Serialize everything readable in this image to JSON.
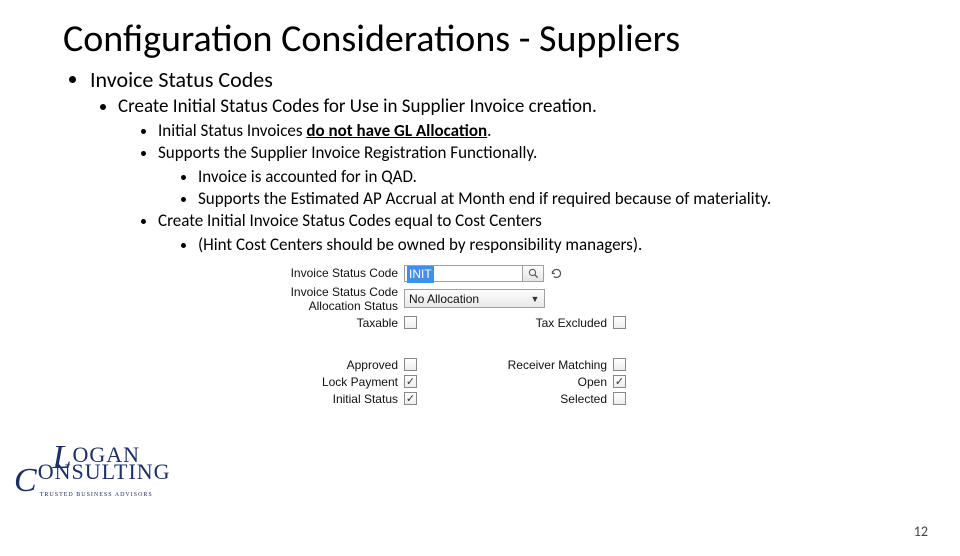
{
  "title": "Configuration Considerations - Suppliers",
  "bullets": {
    "l1": "Invoice Status Codes",
    "l2": "Create Initial Status Codes for Use in Supplier Invoice creation.",
    "l3a_pre": "Initial Status Invoices ",
    "l3a_emph": "do not have GL Allocation",
    "l3a_post": ".",
    "l3b": "Supports the Supplier Invoice Registration Functionally.",
    "l4a": "Invoice is accounted for in QAD.",
    "l4b": "Supports the Estimated AP Accrual at Month end if required because of materiality.",
    "l3c": "Create Initial Invoice Status Codes equal to Cost Centers",
    "l4c": "(Hint Cost Centers should be owned by responsibility managers)."
  },
  "form": {
    "labels": {
      "code": "Invoice Status Code",
      "alloc": "Invoice Status Code Allocation Status",
      "taxable": "Taxable",
      "tax_excluded": "Tax Excluded",
      "approved": "Approved",
      "receiver_matching": "Receiver Matching",
      "lock_payment": "Lock Payment",
      "open": "Open",
      "initial_status": "Initial Status",
      "selected": "Selected"
    },
    "values": {
      "code": "INIT",
      "alloc": "No Allocation",
      "taxable": false,
      "tax_excluded": false,
      "approved": false,
      "receiver_matching": false,
      "lock_payment": true,
      "open": true,
      "initial_status": true,
      "selected": false
    }
  },
  "logo": {
    "line1": "OGAN",
    "line2": "ONSULTING",
    "tagline": "TRUSTED BUSINESS ADVISORS"
  },
  "check_glyph": "✓",
  "dropdown_glyph": "▼",
  "page_number": "12"
}
